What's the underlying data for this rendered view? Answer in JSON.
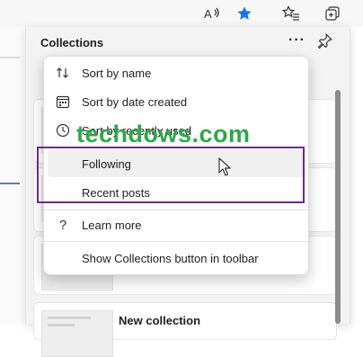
{
  "toolbar": {
    "read_aloud_icon": "read-aloud-icon",
    "favorite_icon": "star-icon",
    "favorites_icon": "favorites-list-icon",
    "collections_icon": "collections-icon",
    "accent": "#1a73e8"
  },
  "collections": {
    "title": "Collections",
    "more_label": "···",
    "new_collection": "New collection"
  },
  "menu": {
    "items": [
      {
        "label": "Sort by name",
        "icon": "sort-icon"
      },
      {
        "label": "Sort by date created",
        "icon": "calendar-icon"
      },
      {
        "label": "Sort by recently used",
        "icon": "clock-icon"
      },
      {
        "label": "Following",
        "icon": ""
      },
      {
        "label": "Recent posts",
        "icon": ""
      },
      {
        "label": "Learn more",
        "icon": "question-icon"
      },
      {
        "label": "Show Collections button in toolbar",
        "icon": ""
      }
    ]
  },
  "watermark": "techdows.com",
  "colors": {
    "highlight": "#6b2d82",
    "watermark": "#2fa84a"
  }
}
